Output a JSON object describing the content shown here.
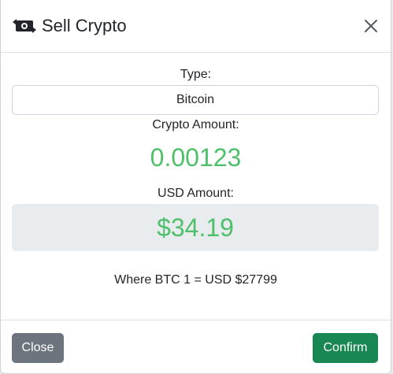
{
  "modal": {
    "title": "Sell Crypto"
  },
  "form": {
    "type_label": "Type:",
    "type_value": "Bitcoin",
    "crypto_label": "Crypto Amount:",
    "crypto_amount": "0.00123",
    "usd_label": "USD Amount:",
    "usd_amount": "$34.19",
    "rate_text": "Where BTC 1 = USD $27799"
  },
  "footer": {
    "close_label": "Close",
    "confirm_label": "Confirm"
  },
  "colors": {
    "amount_green": "#4fc06a",
    "close_button": "#6c757d",
    "confirm_button": "#198754"
  },
  "icons": {
    "title": "money-exchange-icon",
    "close": "close-icon"
  }
}
